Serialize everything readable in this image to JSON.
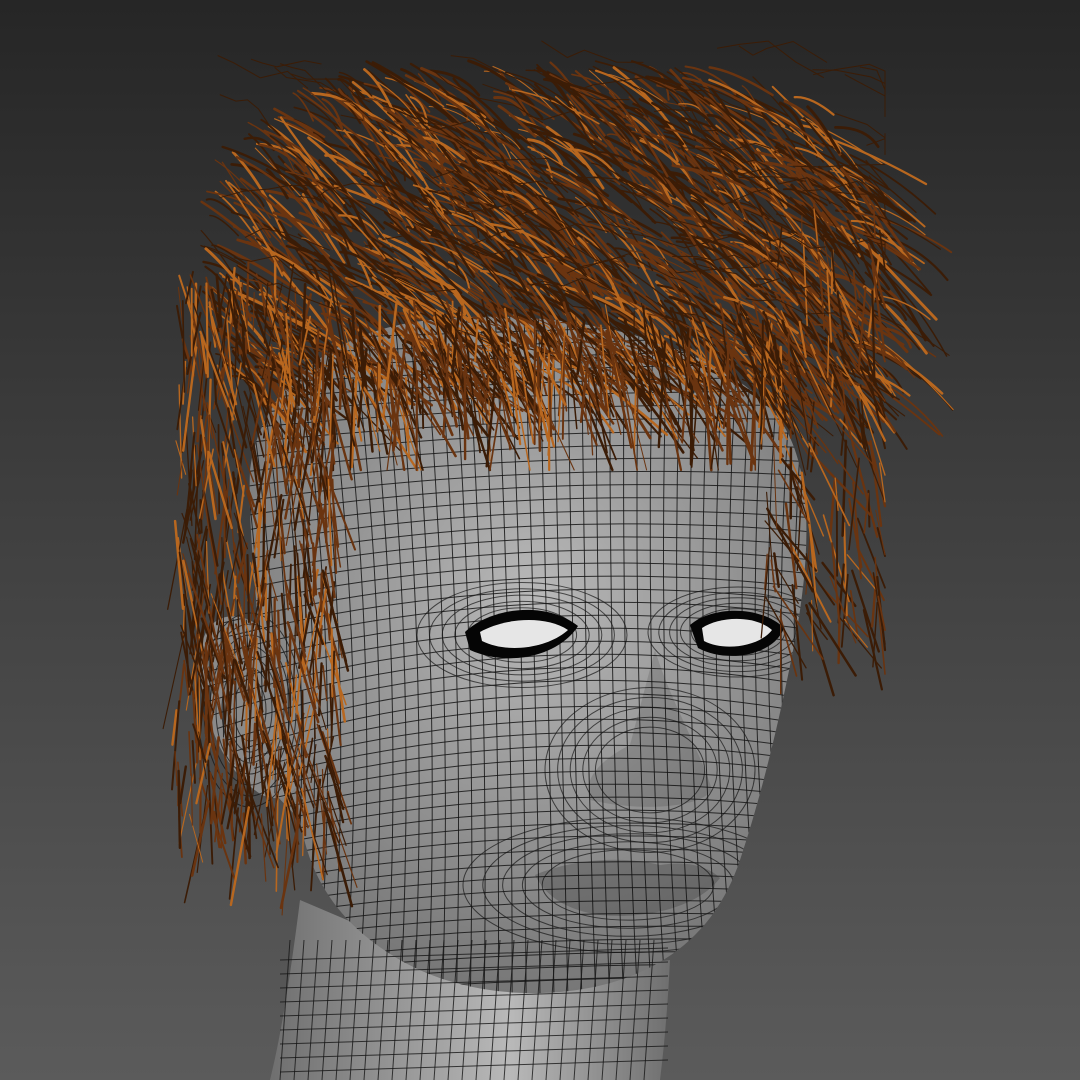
{
  "scene": {
    "kind": "3d-viewport-render",
    "subject": "head-mesh-wireframe-with-hair-strands",
    "colors": {
      "background_top": "#262626",
      "background_bottom": "#5b5b5b",
      "skin_light": "#b9b9b9",
      "skin_dark": "#6f6f6f",
      "wireframe": "#151515",
      "hair_dark": "#3b1c06",
      "hair_mid": "#6a3410",
      "hair_light": "#b8671f",
      "eye_white": "#e6e6e6",
      "eye_rim": "#050505"
    }
  }
}
